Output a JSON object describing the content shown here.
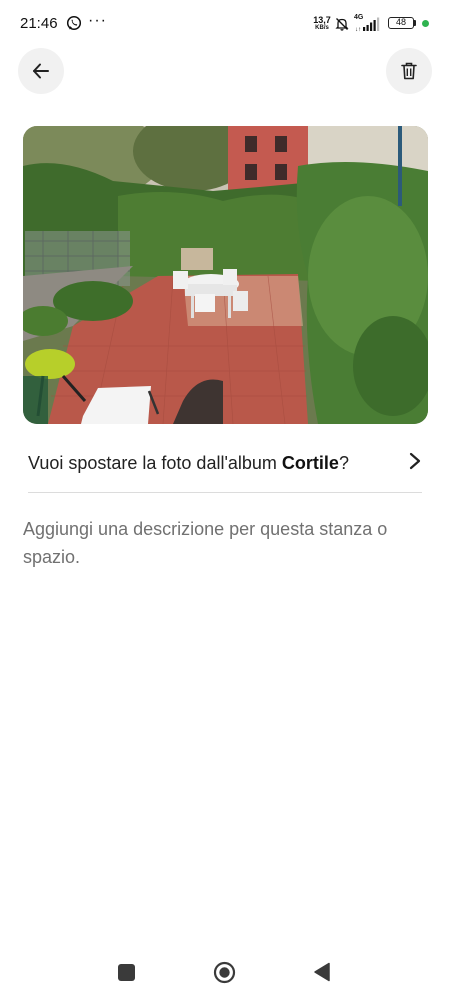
{
  "status_bar": {
    "time": "21:46",
    "more": "···",
    "net_speed_value": "13,7",
    "net_speed_unit": "KB/s",
    "network": "4G",
    "battery_level": "48",
    "battery_fraction": 0.48,
    "dot_color": "#2fb350"
  },
  "header": {
    "back_icon": "arrow-left-icon",
    "delete_icon": "trash-icon"
  },
  "photo": {
    "subject": "courtyard-photo"
  },
  "move_prompt": {
    "prefix": "Vuoi spostare la foto dall'album ",
    "album": "Cortile",
    "suffix": "?"
  },
  "description": {
    "placeholder": "Aggiungi una descrizione per questa stanza o spazio."
  },
  "colors": {
    "accent_dark": "#222222",
    "placeholder": "#717171",
    "button_bg": "#f1f1f1"
  }
}
